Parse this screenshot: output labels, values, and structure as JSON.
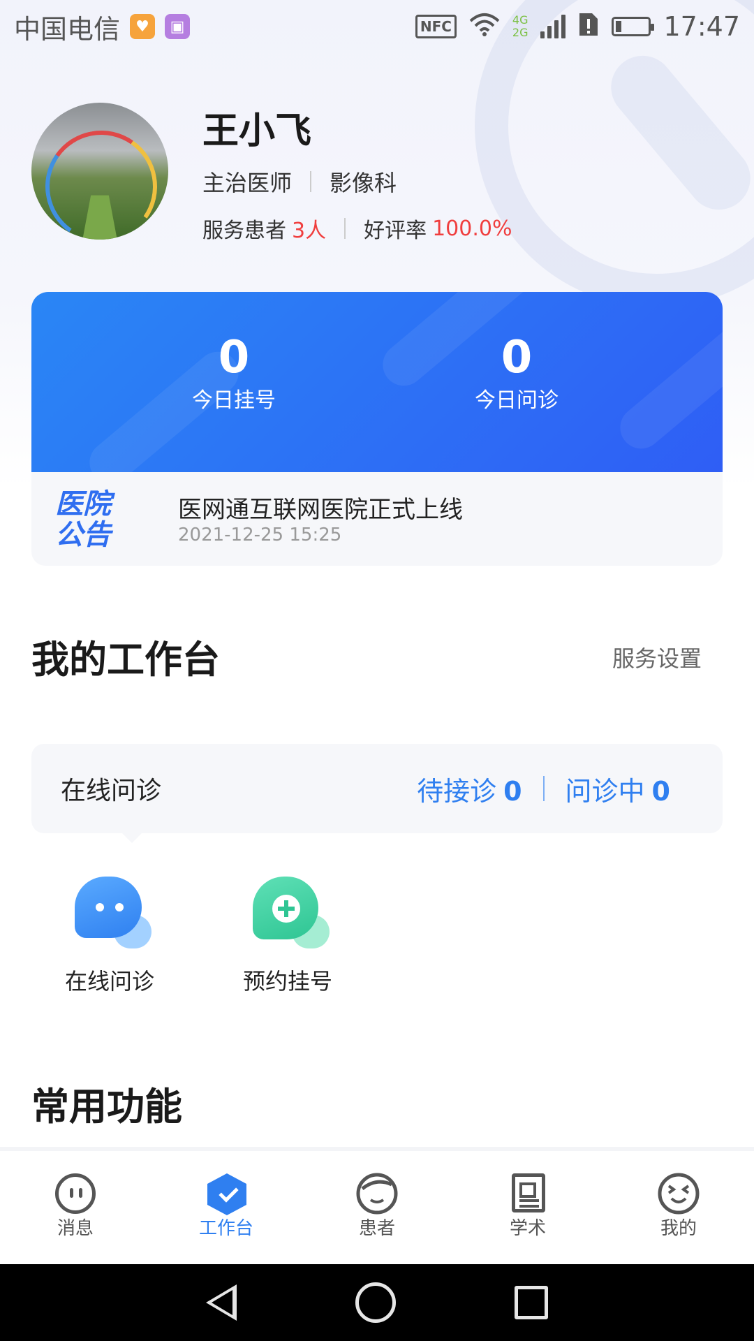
{
  "status_bar": {
    "carrier": "中国电信",
    "nfc_label": "NFC",
    "network_top": "4G",
    "network_bottom": "2G",
    "time": "17:47",
    "icons": [
      "health-app-icon",
      "gallery-app-icon",
      "nfc-icon",
      "wifi-icon",
      "signal-icon",
      "sim-alert-icon",
      "battery-icon"
    ]
  },
  "profile": {
    "name": "王小飞",
    "title": "主治医师",
    "department": "影像科",
    "patients_label": "服务患者",
    "patients_value": "3人",
    "rating_label": "好评率",
    "rating_value": "100.0%"
  },
  "today": {
    "registrations_value": "0",
    "registrations_label": "今日挂号",
    "consultations_value": "0",
    "consultations_label": "今日问诊"
  },
  "notice": {
    "logo_line1": "医院",
    "logo_line2": "公告",
    "title": "医网通互联网医院正式上线",
    "time": "2021-12-25 15:25"
  },
  "workspace": {
    "title": "我的工作台",
    "settings_label": "服务设置",
    "consult_label": "在线问诊",
    "pending_label": "待接诊",
    "pending_value": "0",
    "ongoing_label": "问诊中",
    "ongoing_value": "0",
    "tools": [
      {
        "label": "在线问诊",
        "icon": "chat-bubble-icon"
      },
      {
        "label": "预约挂号",
        "icon": "add-appointment-icon"
      }
    ]
  },
  "common": {
    "title": "常用功能"
  },
  "tabbar": {
    "active": "工作台",
    "accent_color": "#2f7ff0",
    "items": [
      {
        "label": "消息",
        "icon": "message-face-icon"
      },
      {
        "label": "工作台",
        "icon": "workbench-icon"
      },
      {
        "label": "患者",
        "icon": "patient-icon"
      },
      {
        "label": "学术",
        "icon": "academic-doc-icon"
      },
      {
        "label": "我的",
        "icon": "profile-smile-icon"
      }
    ]
  },
  "colors": {
    "primary_blue": "#2f6ef0",
    "highlight_red": "#f03e3e",
    "green_accent": "#2ec593"
  }
}
